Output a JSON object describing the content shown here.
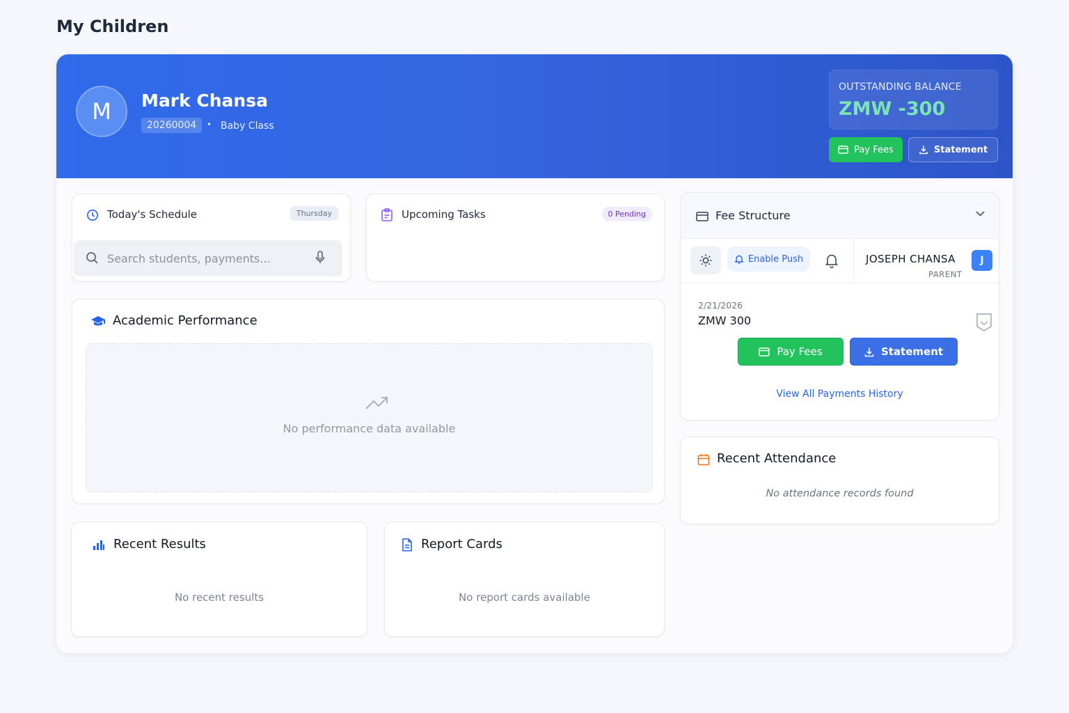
{
  "page": {
    "title": "My Children"
  },
  "student": {
    "avatar_initial": "M",
    "name": "Mark Chansa",
    "id": "20260004",
    "separator": "•",
    "class_name": "Baby Class"
  },
  "balance": {
    "label": "OUTSTANDING BALANCE",
    "value": "ZMW -300",
    "value_color": "#7be3b4"
  },
  "hero_actions": {
    "pay_label": "Pay Fees",
    "statement_label": "Statement"
  },
  "schedule": {
    "title": "Today's Schedule",
    "day_badge": "Thursday",
    "search_placeholder": "Search students, payments..."
  },
  "tasks": {
    "title": "Upcoming Tasks",
    "pending_badge": "0 Pending"
  },
  "academic": {
    "title": "Academic Performance",
    "empty_text": "No performance data available"
  },
  "results": {
    "title": "Recent Results",
    "empty_text": "No recent results"
  },
  "report_cards": {
    "title": "Report Cards",
    "empty_text": "No report cards available"
  },
  "fee_structure": {
    "title": "Fee Structure",
    "enable_push_label": "Enable Push",
    "user_name": "JOSEPH  CHANSA",
    "user_role": "PARENT",
    "user_initial": "J",
    "entry_date": "2/21/2026",
    "entry_amount": "ZMW 300",
    "pay_label": "Pay Fees",
    "statement_label": "Statement",
    "history_link": "View All Payments History"
  },
  "attendance": {
    "title": "Recent Attendance",
    "empty_text": "No attendance records found"
  },
  "colors": {
    "brand_blue": "#2f6bea",
    "success_green": "#22c25c",
    "link_blue": "#2563eb",
    "purple": "#7c3aed",
    "orange": "#f97316"
  },
  "icons": {
    "schedule": "clock-icon",
    "tasks": "clipboard-icon",
    "academic": "graduation-cap-icon",
    "results": "bar-chart-icon",
    "report_cards": "file-text-icon",
    "fee": "credit-card-icon",
    "attendance": "calendar-icon",
    "empty_chart": "trending-up-icon"
  }
}
